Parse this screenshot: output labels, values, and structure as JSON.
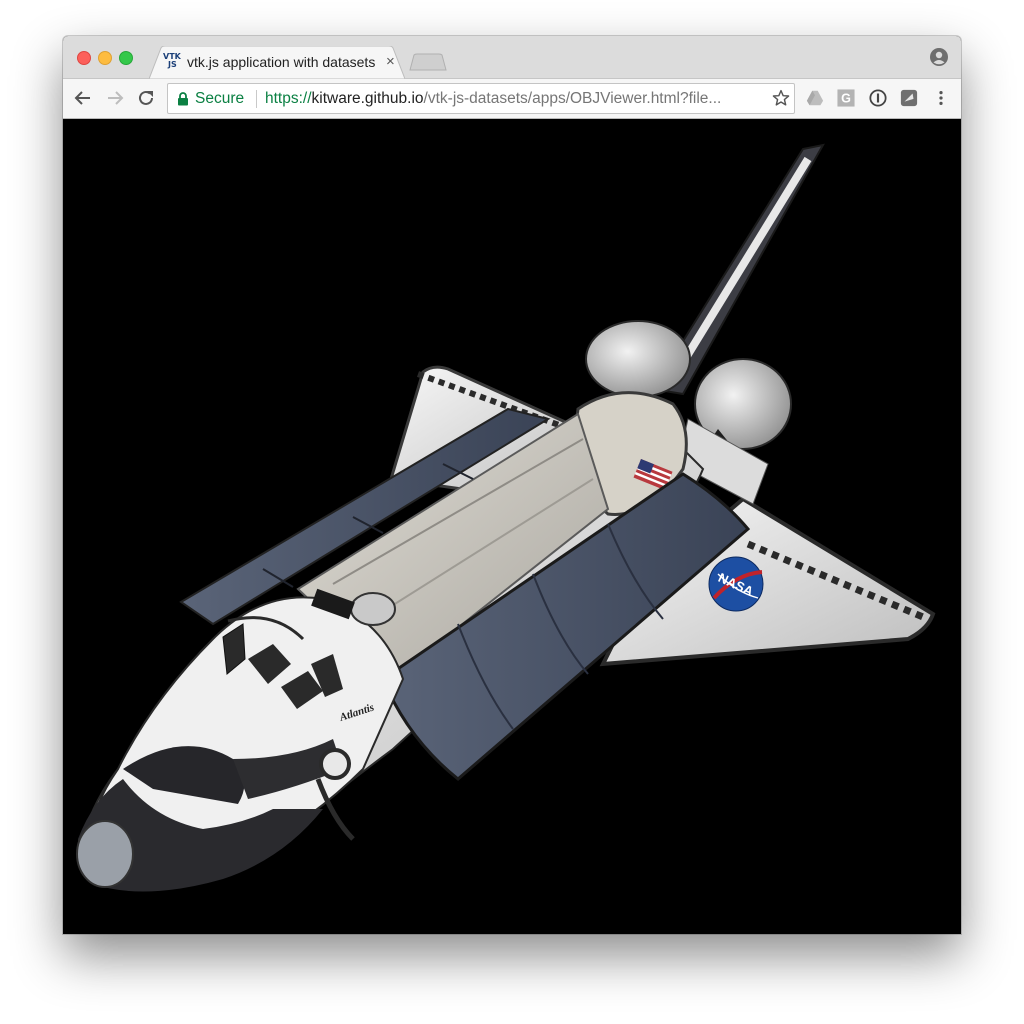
{
  "browser": {
    "tab": {
      "favicon_text_top": "VTK",
      "favicon_text_bottom": "JS",
      "title": "vtk.js application with datasets",
      "close_glyph": "×"
    },
    "omnibox": {
      "secure_label": "Secure",
      "url_scheme": "https://",
      "url_host": "kitware.github.io",
      "url_path": "/vtk-js-datasets/apps/OBJViewer.html?file..."
    },
    "toolbar_icons": [
      "back-icon",
      "forward-icon",
      "reload-icon",
      "star-icon",
      "google-drive-icon",
      "g-extension-icon",
      "1password-icon",
      "extension-icon",
      "menu-icon"
    ],
    "profile_icon": "profile-icon"
  },
  "scene": {
    "model": "space-shuttle",
    "shuttle_name_label": "Atlantis",
    "logo_text": "NASA",
    "colors": {
      "background": "#000000",
      "hull": "#e8e8e8",
      "panels": "#4a5468",
      "nose": "#2a2a2e",
      "nasa_blue": "#1d4fa3"
    }
  }
}
